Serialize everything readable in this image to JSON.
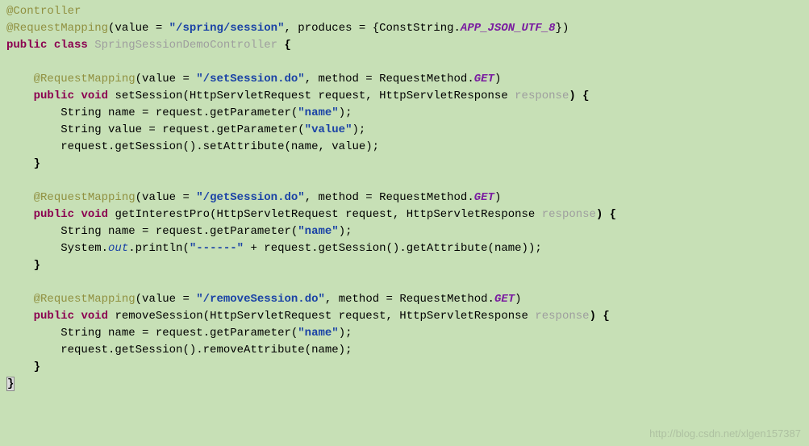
{
  "code": {
    "l1_ann": "@Controller",
    "l2_ann": "@RequestMapping",
    "l2_rest": "(value = ",
    "l2_str": "\"/spring/session\"",
    "l2_mid": ", produces = {ConstString.",
    "l2_const": "APP_JSON_UTF_8",
    "l2_end": "})",
    "l3_kw1": "public",
    "l3_kw2": "class",
    "l3_cn": "SpringSessionDemoController",
    "l3_end": " {",
    "l5_ann": "@RequestMapping",
    "l5_rest": "(value = ",
    "l5_str": "\"/setSession.do\"",
    "l5_mid": ", method = RequestMethod.",
    "l5_const": "GET",
    "l5_end": ")",
    "l6_kw1": "public",
    "l6_kw2": "void",
    "l6_mid": " setSession(HttpServletRequest request, HttpServletResponse ",
    "l6_gray": "response",
    "l6_end": ") {",
    "l7_a": "String name = request.getParameter(",
    "l7_str": "\"name\"",
    "l7_end": ");",
    "l8_a": "String value = request.getParameter(",
    "l8_str": "\"value\"",
    "l8_end": ");",
    "l9": "request.getSession().setAttribute(name, value);",
    "l10": "}",
    "l12_ann": "@RequestMapping",
    "l12_rest": "(value = ",
    "l12_str": "\"/getSession.do\"",
    "l12_mid": ", method = RequestMethod.",
    "l12_const": "GET",
    "l12_end": ")",
    "l13_kw1": "public",
    "l13_kw2": "void",
    "l13_mid": " getInterestPro(HttpServletRequest request, HttpServletResponse ",
    "l13_gray": "response",
    "l13_end": ") {",
    "l14_a": "String name = request.getParameter(",
    "l14_str": "\"name\"",
    "l14_end": ");",
    "l15_a": "System.",
    "l15_static": "out",
    "l15_b": ".println(",
    "l15_str": "\"------\"",
    "l15_c": " + request.getSession().getAttribute(name));",
    "l16": "}",
    "l18_ann": "@RequestMapping",
    "l18_rest": "(value = ",
    "l18_str": "\"/removeSession.do\"",
    "l18_mid": ", method = RequestMethod.",
    "l18_const": "GET",
    "l18_end": ")",
    "l19_kw1": "public",
    "l19_kw2": "void",
    "l19_mid": " removeSession(HttpServletRequest request, HttpServletResponse ",
    "l19_gray": "response",
    "l19_end": ") {",
    "l20_a": "String name = request.getParameter(",
    "l20_str": "\"name\"",
    "l20_end": ");",
    "l21": "request.getSession().removeAttribute(name);",
    "l22": "}",
    "l23": "}"
  },
  "watermark": "http://blog.csdn.net/xlgen157387"
}
